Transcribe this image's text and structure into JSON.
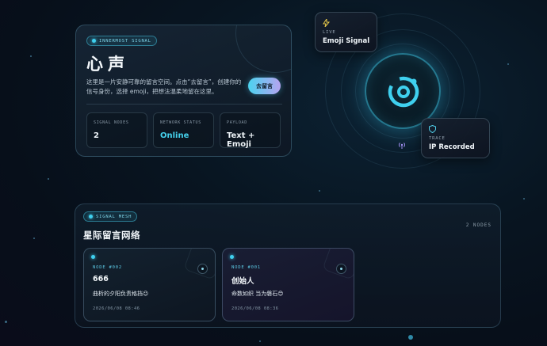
{
  "hero": {
    "tag": "INNERMOST SIGNAL",
    "title": "心声",
    "description": "这里是一片安静可靠的留言空间。点击“去留言”，创建你的信号身份，选择 emoji，把想法温柔地留在这里。",
    "cta_label": "去留言",
    "stats": [
      {
        "label": "SIGNAL NODES",
        "value": "2"
      },
      {
        "label": "NETWORK STATUS",
        "value": "Online"
      },
      {
        "label": "PAYLOAD",
        "value": "Text + Emoji"
      }
    ]
  },
  "orb": {
    "icon": "orbit-icon",
    "live_card": {
      "label": "LIVE",
      "value": "Emoji Signal",
      "icon": "lightning-icon"
    },
    "trace_card": {
      "label": "TRACE",
      "value": "IP Recorded",
      "icon": "shield-icon"
    },
    "signal_icon": "radio-signal-icon"
  },
  "mesh": {
    "tag": "SIGNAL MESH",
    "title": "星际留言网络",
    "count": "2 NODES",
    "nodes": [
      {
        "id": "NODE #002",
        "name": "666",
        "message": "曲析的夕阳负责格挡😉",
        "date": "2026/06/08 08:46"
      },
      {
        "id": "NODE #001",
        "name": "创始人",
        "message": "命数如织 当为磐石😊",
        "date": "2026/06/08 08:36"
      }
    ]
  },
  "colors": {
    "accent": "#45d3ee",
    "accent_violet": "#b6a3f0",
    "background": "#081521"
  }
}
